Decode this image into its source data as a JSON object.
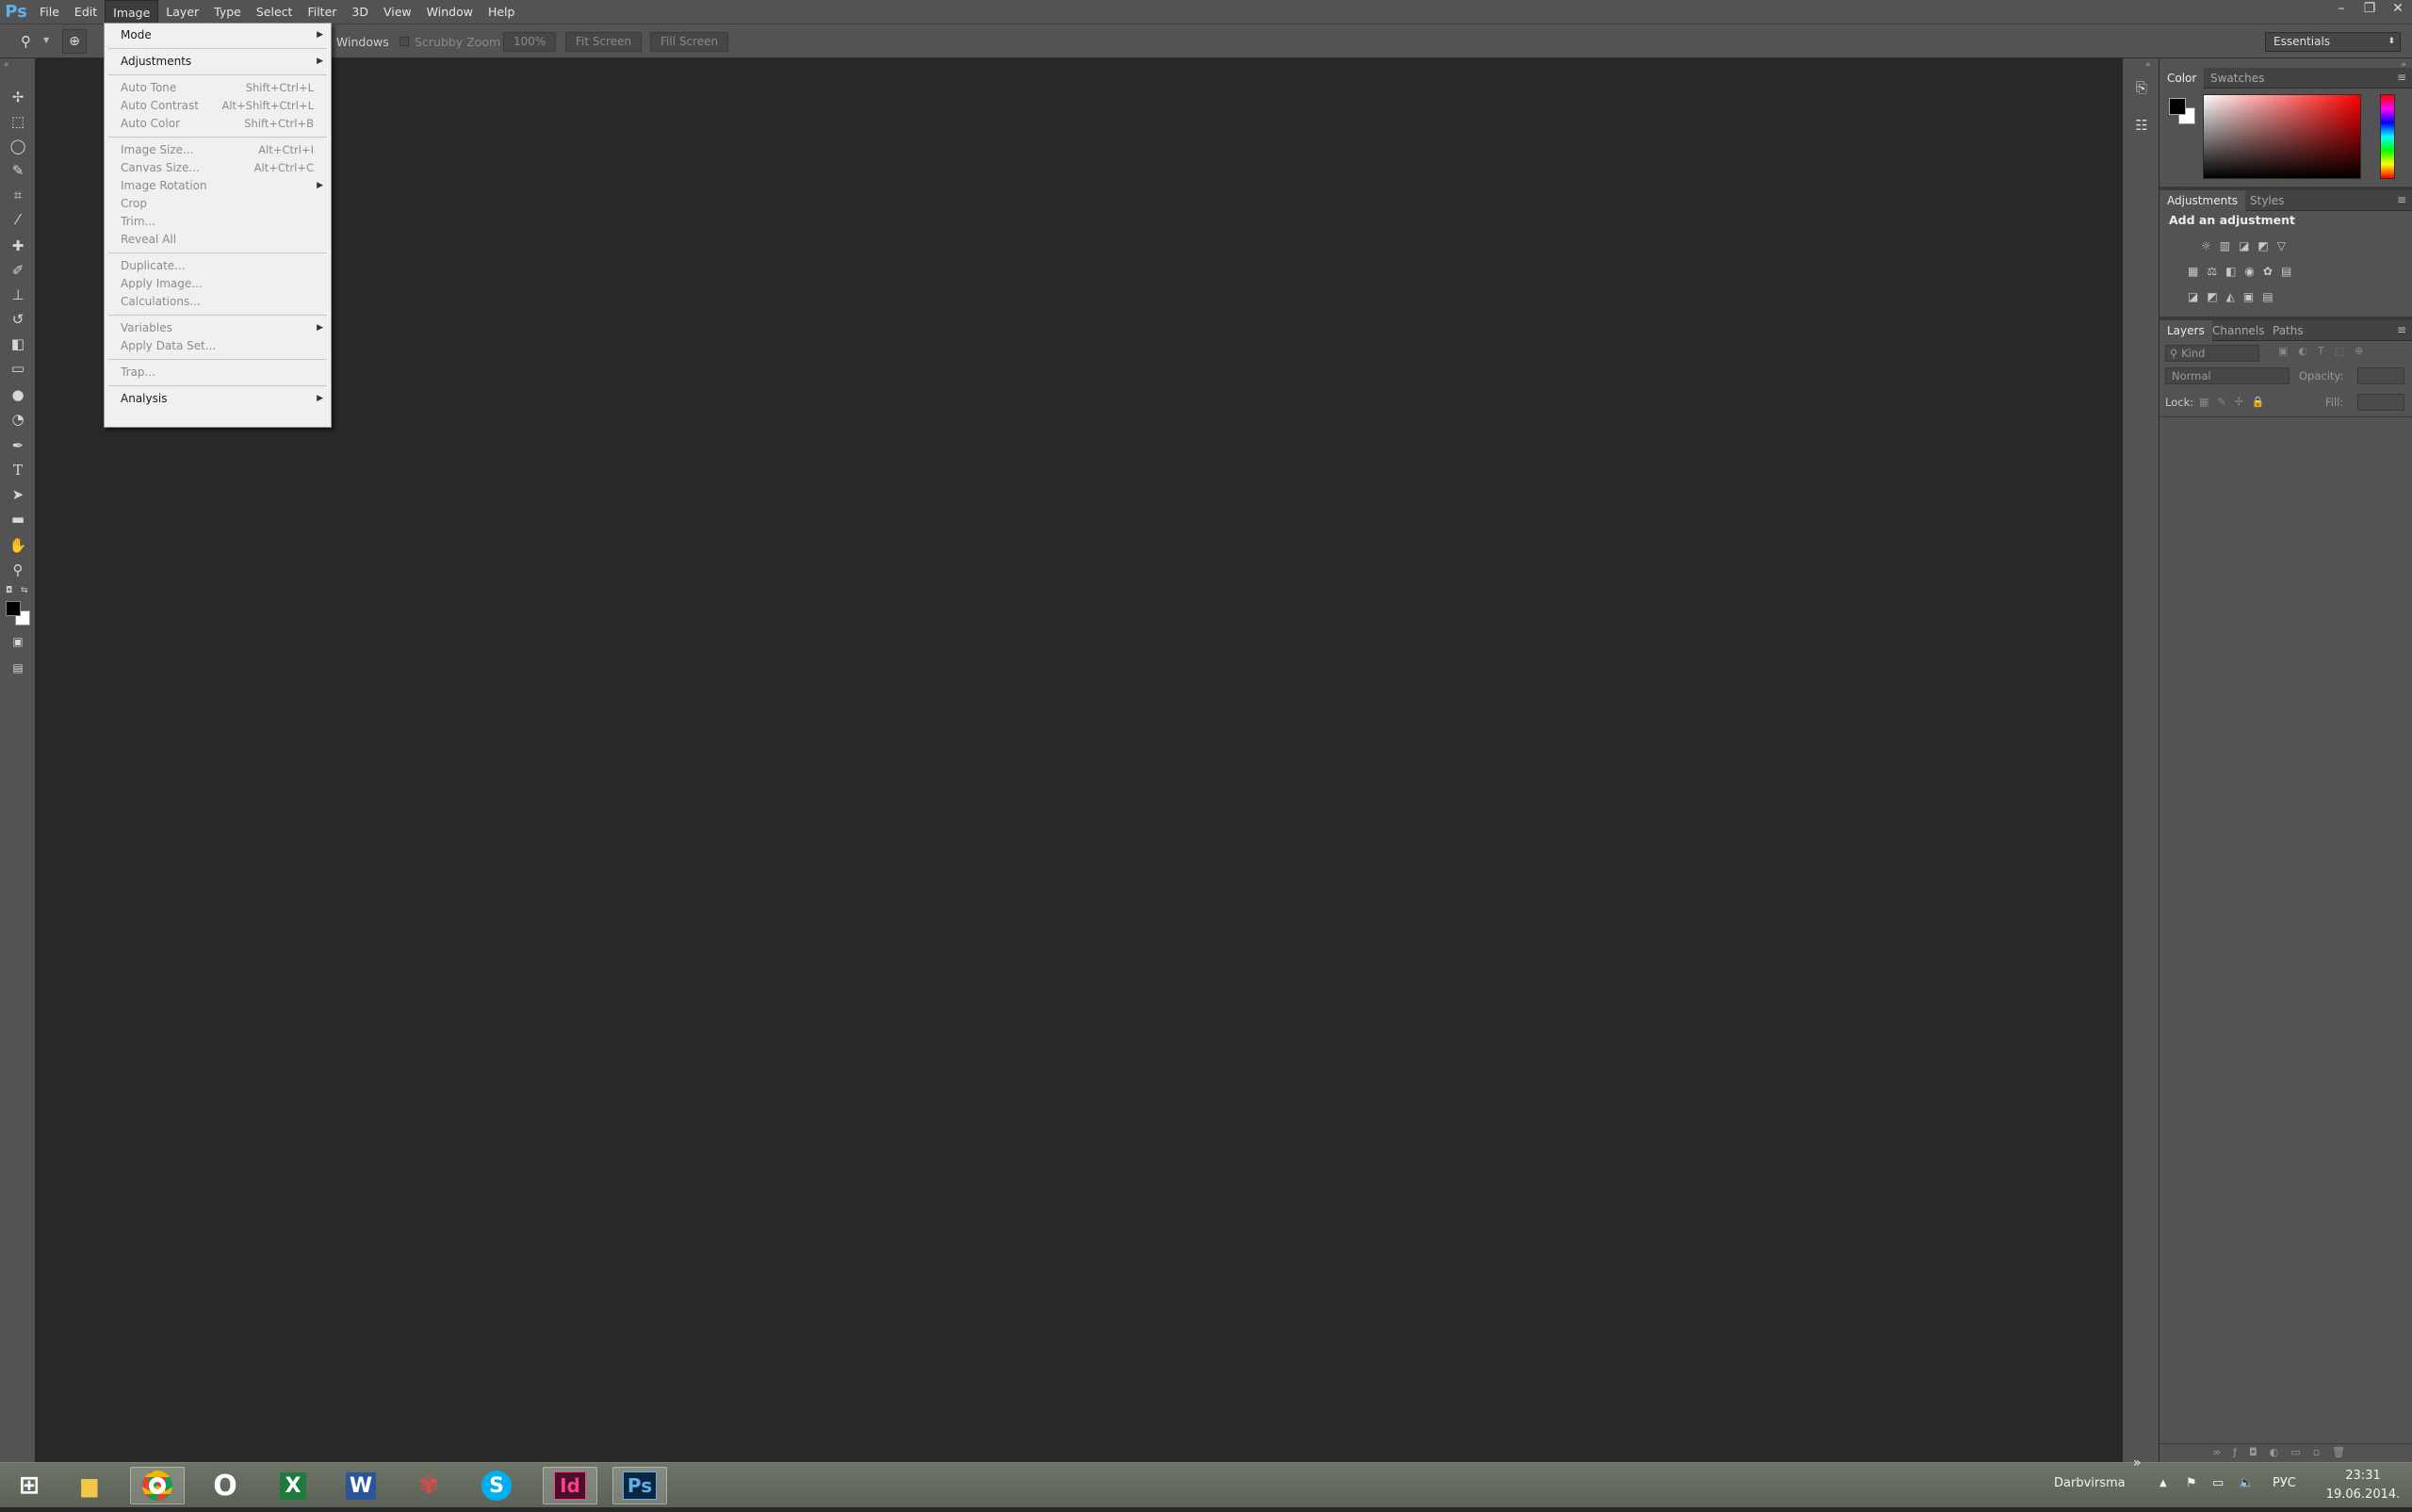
{
  "app": {
    "logo": "Ps"
  },
  "menubar": {
    "items": [
      "File",
      "Edit",
      "Image",
      "Layer",
      "Type",
      "Select",
      "Filter",
      "3D",
      "View",
      "Window",
      "Help"
    ],
    "active": "Image"
  },
  "window_controls": [
    "–",
    "❐",
    "✕"
  ],
  "options_bar": {
    "partial_label": "ll Windows",
    "scrubby_zoom": "Scrubby Zoom",
    "zoom_value": "100%",
    "fit_screen": "Fit Screen",
    "fill_screen": "Fill Screen",
    "workspace": "Essentials"
  },
  "image_menu": {
    "items": [
      {
        "label": "Mode",
        "shortcut": "",
        "submenu": true,
        "enabled": true
      },
      {
        "sep": true
      },
      {
        "label": "Adjustments",
        "shortcut": "",
        "submenu": true,
        "enabled": true
      },
      {
        "sep": true
      },
      {
        "label": "Auto Tone",
        "shortcut": "Shift+Ctrl+L",
        "enabled": false
      },
      {
        "label": "Auto Contrast",
        "shortcut": "Alt+Shift+Ctrl+L",
        "enabled": false
      },
      {
        "label": "Auto Color",
        "shortcut": "Shift+Ctrl+B",
        "enabled": false
      },
      {
        "sep": true
      },
      {
        "label": "Image Size...",
        "shortcut": "Alt+Ctrl+I",
        "enabled": false
      },
      {
        "label": "Canvas Size...",
        "shortcut": "Alt+Ctrl+C",
        "enabled": false
      },
      {
        "label": "Image Rotation",
        "shortcut": "",
        "submenu": true,
        "enabled": false
      },
      {
        "label": "Crop",
        "shortcut": "",
        "enabled": false
      },
      {
        "label": "Trim...",
        "shortcut": "",
        "enabled": false
      },
      {
        "label": "Reveal All",
        "shortcut": "",
        "enabled": false
      },
      {
        "sep": true
      },
      {
        "label": "Duplicate...",
        "shortcut": "",
        "enabled": false
      },
      {
        "label": "Apply Image...",
        "shortcut": "",
        "enabled": false
      },
      {
        "label": "Calculations...",
        "shortcut": "",
        "enabled": false
      },
      {
        "sep": true
      },
      {
        "label": "Variables",
        "shortcut": "",
        "submenu": true,
        "enabled": false
      },
      {
        "label": "Apply Data Set...",
        "shortcut": "",
        "enabled": false
      },
      {
        "sep": true
      },
      {
        "label": "Trap...",
        "shortcut": "",
        "enabled": false
      },
      {
        "sep": true
      },
      {
        "label": "Analysis",
        "shortcut": "",
        "submenu": true,
        "enabled": true
      }
    ]
  },
  "panels": {
    "color_tabs": [
      "Color",
      "Swatches"
    ],
    "adjust_tabs": [
      "Adjustments",
      "Styles"
    ],
    "adjust_heading": "Add an adjustment",
    "layers_tabs": [
      "Layers",
      "Channels",
      "Paths"
    ],
    "kind_label": "Kind",
    "blend_mode": "Normal",
    "opacity_label": "Opacity:",
    "lock_label": "Lock:",
    "fill_label": "Fill:"
  },
  "taskbar": {
    "user": "Darbvirsma",
    "lang": "РУС",
    "time": "23:31",
    "date": "19.06.2014."
  },
  "colors": {
    "accent": "#5fb0e8",
    "bg": "#282828",
    "panel": "#535353"
  }
}
